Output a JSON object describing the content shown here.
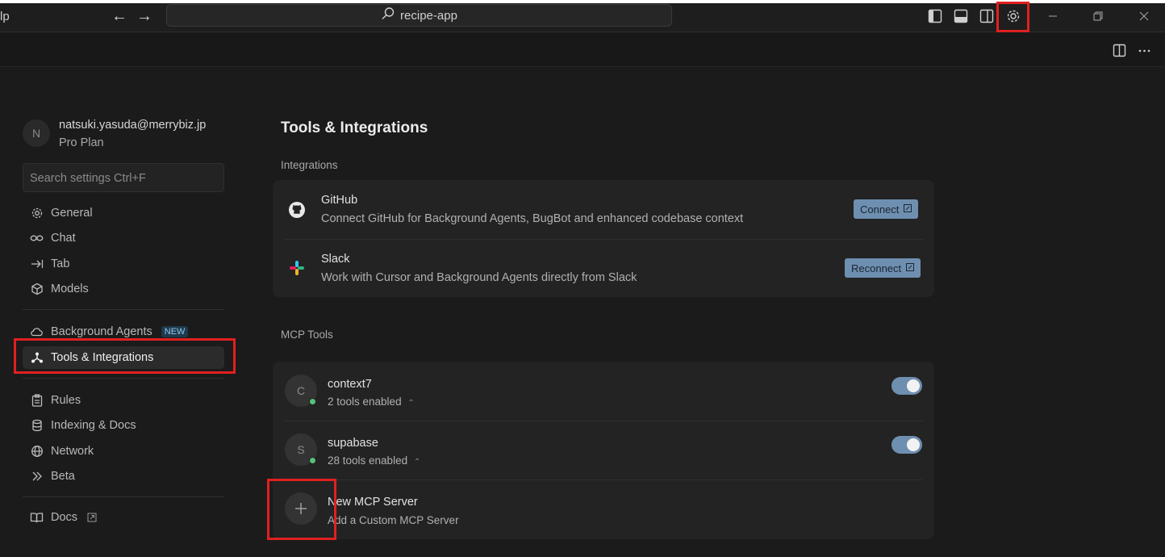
{
  "titlebar": {
    "menu_fragment": "lp",
    "back_glyph": "←",
    "forward_glyph": "→",
    "search_text": "recipe-app",
    "icons": [
      "toggle-primary-sidebar-icon",
      "toggle-panel-icon",
      "toggle-secondary-sidebar-icon",
      "settings-gear-icon"
    ],
    "window_controls": [
      "minimize-icon",
      "restore-icon",
      "close-icon"
    ]
  },
  "secondbar": {
    "icons": [
      "split-editor-icon",
      "more-actions-icon"
    ]
  },
  "profile": {
    "initial": "N",
    "email": "natsuki.yasuda@merrybiz.jp",
    "plan": "Pro Plan"
  },
  "search": {
    "placeholder": "Search settings Ctrl+F"
  },
  "nav": {
    "general": "General",
    "chat": "Chat",
    "tab": "Tab",
    "models": "Models",
    "background_agents": "Background Agents",
    "new_badge": "NEW",
    "tools": "Tools & Integrations",
    "rules": "Rules",
    "indexing": "Indexing & Docs",
    "network": "Network",
    "beta": "Beta",
    "docs": "Docs"
  },
  "main": {
    "title": "Tools & Integrations",
    "integrations_label": "Integrations",
    "integrations": [
      {
        "name": "GitHub",
        "description": "Connect GitHub for Background Agents, BugBot and enhanced codebase context",
        "button": "Connect"
      },
      {
        "name": "Slack",
        "description": "Work with Cursor and Background Agents directly from Slack",
        "button": "Reconnect"
      }
    ],
    "mcp_label": "MCP Tools",
    "mcp_servers": [
      {
        "initial": "C",
        "name": "context7",
        "tools": "2 tools enabled",
        "enabled": true
      },
      {
        "initial": "S",
        "name": "supabase",
        "tools": "28 tools enabled",
        "enabled": true
      }
    ],
    "new_server": {
      "title": "New MCP Server",
      "subtitle": "Add a Custom MCP Server"
    }
  },
  "colors": {
    "accent": "#6e8fb0",
    "highlight_box": "#e02020",
    "status_green": "#58c07a",
    "new_badge_bg": "#1f3a4c"
  }
}
